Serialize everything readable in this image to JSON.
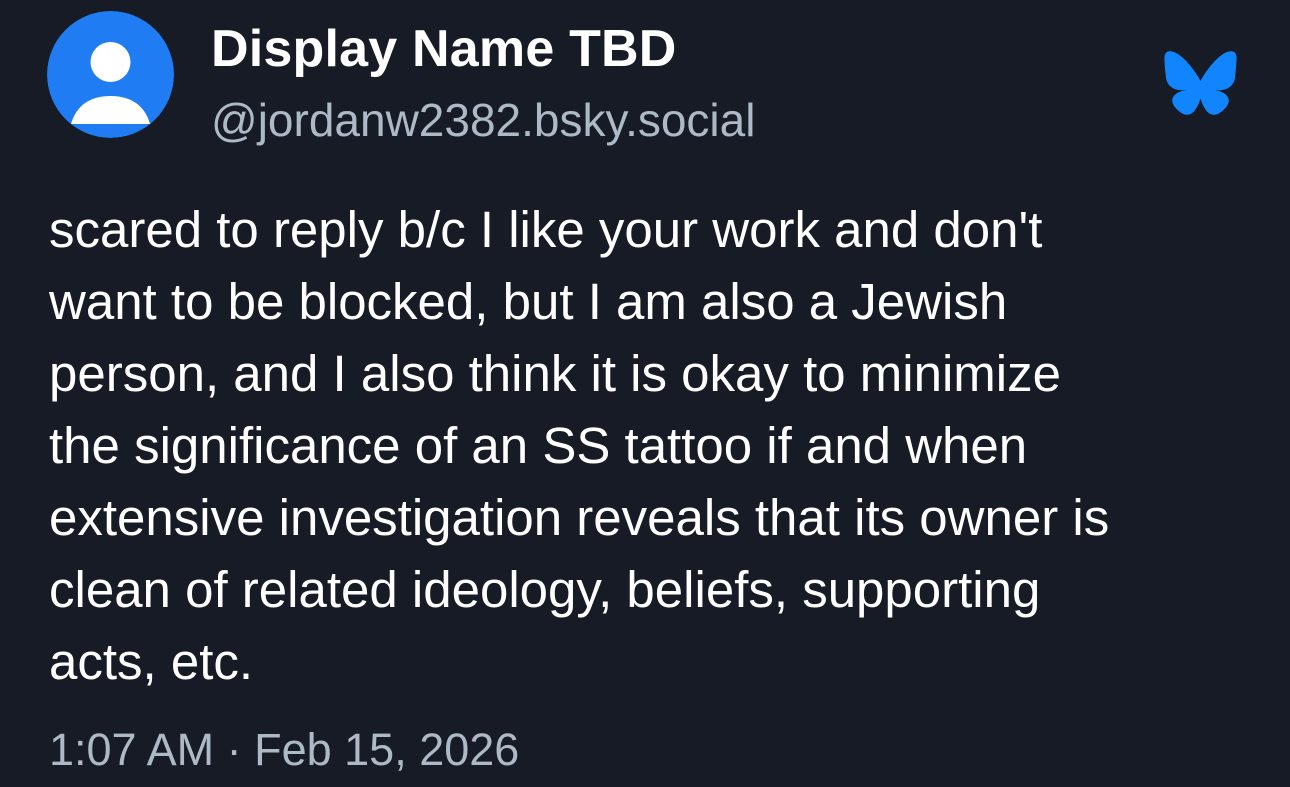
{
  "author": {
    "display_name": "Display Name TBD",
    "handle": "@jordanw2382.bsky.social",
    "avatar_icon": "default-user-avatar-icon"
  },
  "app": {
    "logo_icon": "bluesky-butterfly-icon",
    "logo_color": "#1185fe"
  },
  "post": {
    "text": "scared to reply b/c I like your work and don't\nwant to be blocked, but I am also a Jewish\nperson, and I also think it is okay to minimize\nthe significance of an SS tattoo if and when\nextensive investigation reveals that its owner is\nclean of related ideology, beliefs, supporting\nacts, etc.",
    "timestamp": "1:07 AM · Feb 15, 2026"
  },
  "colors": {
    "background": "#161b25",
    "text_primary": "#ffffff",
    "text_secondary": "#aeb9c6",
    "avatar_bg": "#1f7cf2"
  }
}
